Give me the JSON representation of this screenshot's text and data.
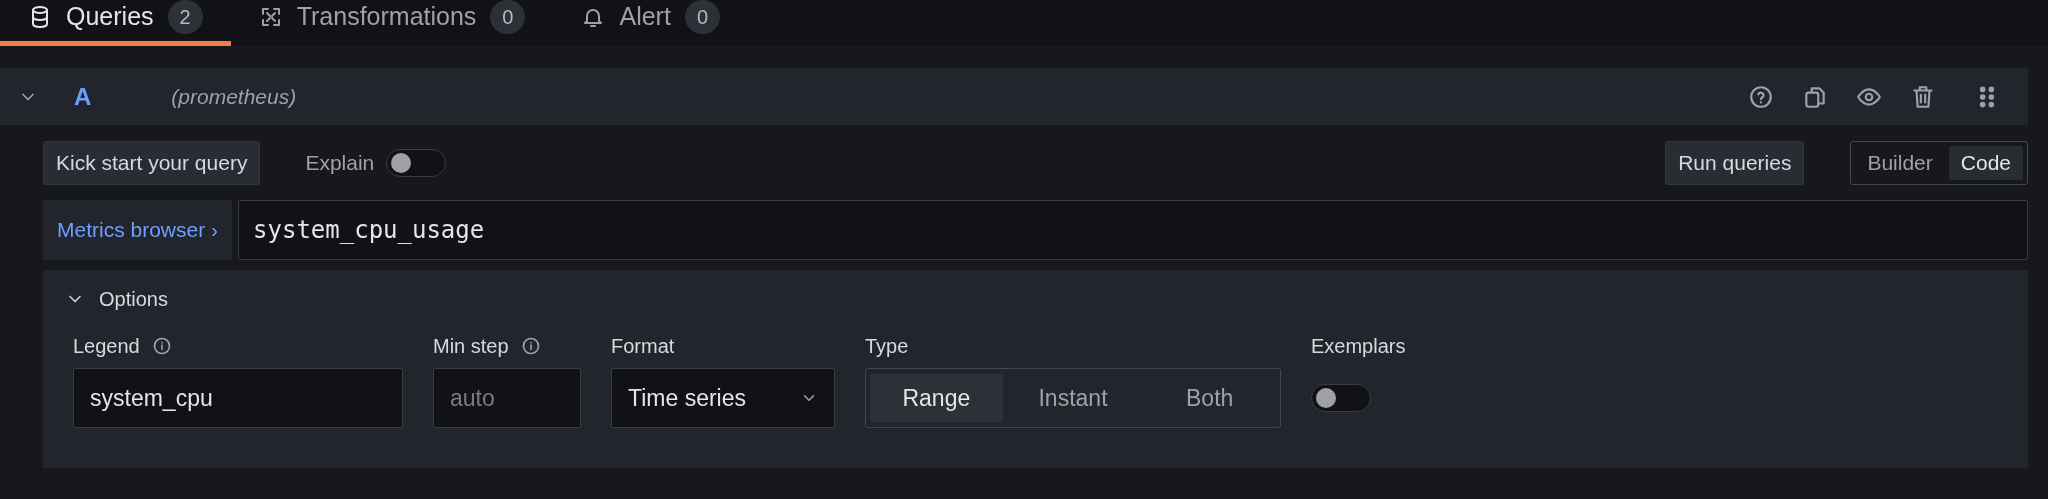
{
  "tabs": [
    {
      "label": "Queries",
      "count": "2",
      "selected": true,
      "kind": "database"
    },
    {
      "label": "Transformations",
      "count": "0",
      "selected": false,
      "kind": "transform"
    },
    {
      "label": "Alert",
      "count": "0",
      "selected": false,
      "kind": "bell"
    }
  ],
  "query": {
    "letter": "A",
    "datasource": "(prometheus)",
    "expanded": true,
    "kick_start": "Kick start your query",
    "explain": {
      "label": "Explain",
      "on": false
    },
    "run": "Run queries",
    "modes": [
      {
        "label": "Builder",
        "selected": false
      },
      {
        "label": "Code",
        "selected": true
      }
    ],
    "metrics_browser": "Metrics browser ›",
    "expression": "system_cpu_usage",
    "options": {
      "title": "Options",
      "expanded": true,
      "legend": {
        "label": "Legend",
        "value": "system_cpu"
      },
      "min_step": {
        "label": "Min step",
        "placeholder": "auto"
      },
      "format": {
        "label": "Format",
        "value": "Time series"
      },
      "type": {
        "label": "Type",
        "choices": [
          {
            "label": "Range",
            "selected": true
          },
          {
            "label": "Instant",
            "selected": false
          },
          {
            "label": "Both",
            "selected": false
          }
        ]
      },
      "exemplars": {
        "label": "Exemplars",
        "on": false
      }
    }
  }
}
